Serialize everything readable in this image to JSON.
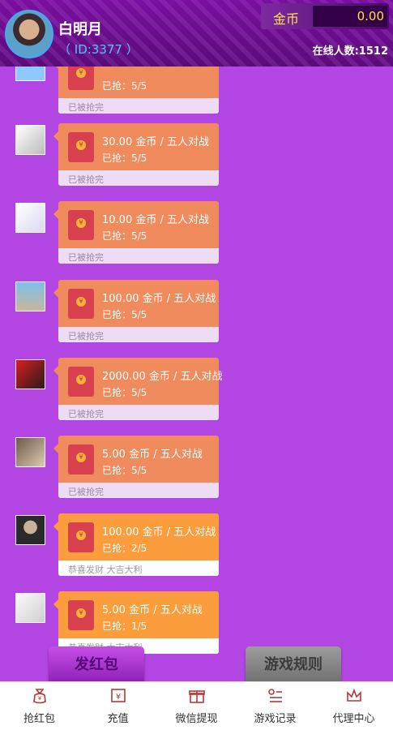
{
  "header": {
    "username": "白明月",
    "user_id": "（ ID:3377 ）",
    "coin_label": "金币",
    "coin_value": "0.00",
    "online_text": "在线人数:1512"
  },
  "messages": [
    {
      "amount": "",
      "grabbed": "已抢：5/5",
      "status": "已被抢完",
      "active": false
    },
    {
      "amount": "30.00 金币 / 五人对战",
      "grabbed": "已抢：5/5",
      "status": "已被抢完",
      "active": false
    },
    {
      "amount": "10.00 金币 / 五人对战",
      "grabbed": "已抢：5/5",
      "status": "已被抢完",
      "active": false
    },
    {
      "amount": "100.00 金币 / 五人对战",
      "grabbed": "已抢：5/5",
      "status": "已被抢完",
      "active": false
    },
    {
      "amount": "2000.00 金币 / 五人对战",
      "grabbed": "已抢：5/5",
      "status": "已被抢完",
      "active": false
    },
    {
      "amount": "5.00 金币 / 五人对战",
      "grabbed": "已抢：5/5",
      "status": "已被抢完",
      "active": false
    },
    {
      "amount": "100.00 金币 / 五人对战",
      "grabbed": "已抢：2/5",
      "status": "恭喜发财 大吉大利",
      "active": true
    },
    {
      "amount": "5.00 金币 / 五人对战",
      "grabbed": "已抢：1/5",
      "status": "恭喜发财 大吉大利",
      "active": true
    }
  ],
  "buttons": {
    "send_red_packet": "发红包",
    "game_rules": "游戏规则"
  },
  "nav": [
    {
      "label": "抢红包",
      "icon": "money-bag-icon"
    },
    {
      "label": "充值",
      "icon": "yuan-card-icon"
    },
    {
      "label": "微信提现",
      "icon": "gift-icon"
    },
    {
      "label": "游戏记录",
      "icon": "list-icon"
    },
    {
      "label": "代理中心",
      "icon": "crown-icon"
    }
  ]
}
